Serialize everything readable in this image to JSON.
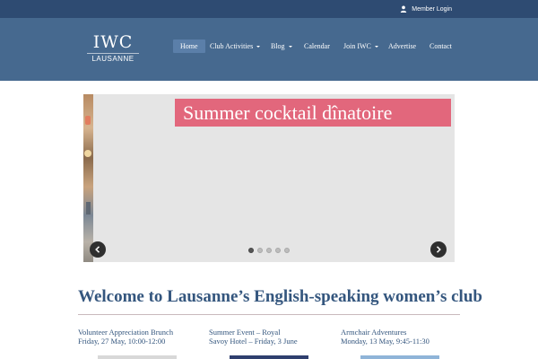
{
  "topbar": {
    "member_login": "Member Login",
    "icon": "user-icon"
  },
  "logo": {
    "main": "IWC",
    "sub": "LAUSANNE"
  },
  "nav": {
    "items": [
      {
        "label": "Home",
        "active": true
      },
      {
        "label": "Club Activities",
        "dropdown": true
      },
      {
        "label": "Blog",
        "dropdown": true
      },
      {
        "label": "Calendar"
      },
      {
        "label": "Join IWC",
        "dropdown": true
      },
      {
        "label": "Advertise"
      },
      {
        "label": "Contact"
      }
    ]
  },
  "slider": {
    "banner_text": "Summer cocktail dînatoire",
    "slide_count": 5,
    "active_slide": 1
  },
  "main": {
    "welcome_title": "Welcome to Lausanne’s English-speaking women’s club"
  },
  "events": [
    {
      "line1": "Volunteer Appreciation Brunch",
      "line2": "Friday, 27 May, 10:00-12:00"
    },
    {
      "line1": "Summer Event – Royal",
      "line2": "Savoy Hotel – Friday, 3 June"
    },
    {
      "line1": "Armchair Adventures",
      "line2": "Monday, 13 May, 9:45-11:30"
    }
  ],
  "colors": {
    "topbar": "#2e4b72",
    "header": "#46698f",
    "banner": "#e2677c",
    "heading": "#34567e"
  }
}
